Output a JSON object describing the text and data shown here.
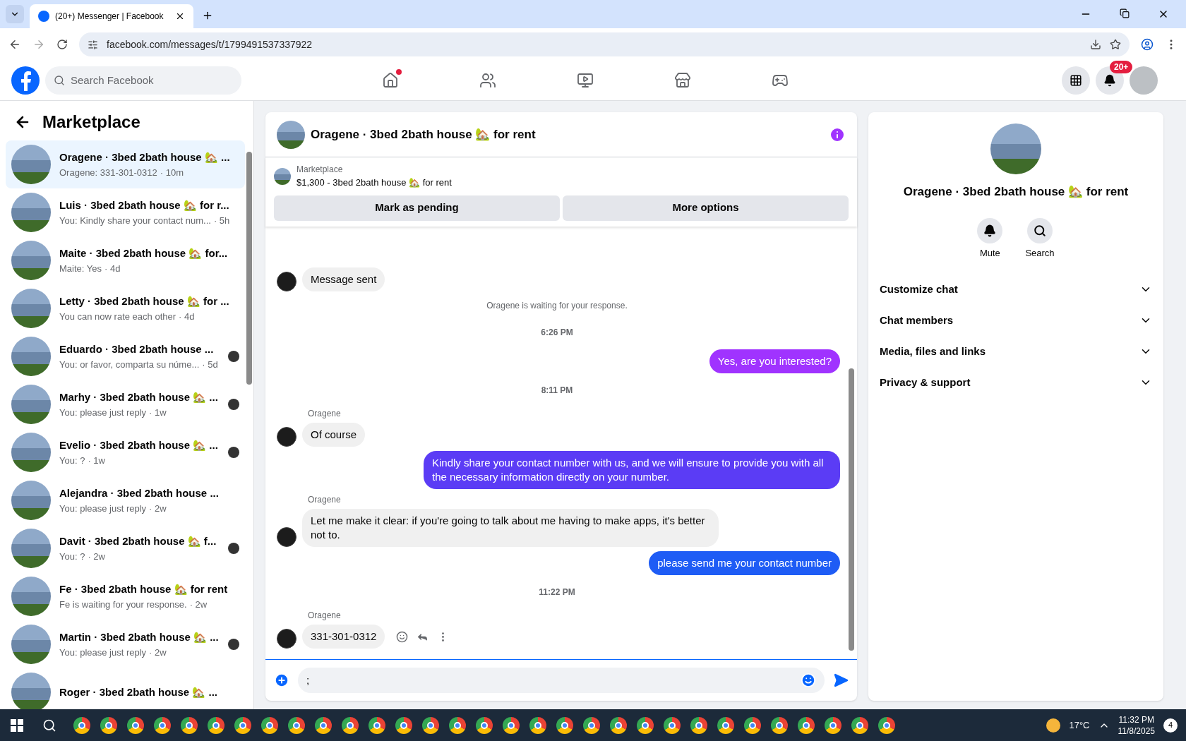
{
  "browser": {
    "tab_title": "(20+) Messenger | Facebook",
    "url": "facebook.com/messages/t/1799491537337922"
  },
  "header": {
    "search_placeholder": "Search Facebook",
    "nav": [
      {
        "kind": "home",
        "dot": true
      },
      {
        "kind": "friends",
        "dot": false
      },
      {
        "kind": "video",
        "dot": false
      },
      {
        "kind": "marketplace",
        "dot": false
      },
      {
        "kind": "gaming",
        "dot": false
      }
    ],
    "notification_badge": "20+"
  },
  "sidebar": {
    "title": "Marketplace",
    "conversations": [
      {
        "title": "Oragene · 3bed 2bath house 🏡 ...",
        "preview": "Oragene: 331-301-0312",
        "time": "· 10m",
        "selected": true,
        "seen": false
      },
      {
        "title": "Luis · 3bed 2bath house 🏡 for r...",
        "preview": "You: Kindly share your contact num...",
        "time": "· 5h",
        "selected": false,
        "seen": false
      },
      {
        "title": "Maite · 3bed 2bath house 🏡 for...",
        "preview": "Maite: Yes",
        "time": "· 4d",
        "selected": false,
        "seen": false
      },
      {
        "title": "Letty · 3bed 2bath house 🏡 for ...",
        "preview": "You can now rate each other",
        "time": "· 4d",
        "selected": false,
        "seen": false
      },
      {
        "title": "Eduardo · 3bed 2bath house ...",
        "preview": "You: or favor, comparta su núme...",
        "time": "· 5d",
        "selected": false,
        "seen": true
      },
      {
        "title": "Marhy · 3bed 2bath house 🏡 ...",
        "preview": "You: please just reply",
        "time": "· 1w",
        "selected": false,
        "seen": true
      },
      {
        "title": "Evelio · 3bed 2bath house 🏡 ...",
        "preview": "You: ?",
        "time": "· 1w",
        "selected": false,
        "seen": true
      },
      {
        "title": "Alejandra · 3bed 2bath house ...",
        "preview": "You: please just reply",
        "time": "· 2w",
        "selected": false,
        "seen": false
      },
      {
        "title": "Davit · 3bed 2bath house 🏡 f...",
        "preview": "You: ?",
        "time": "· 2w",
        "selected": false,
        "seen": true
      },
      {
        "title": "Fe · 3bed 2bath house 🏡 for rent",
        "preview": "Fe is waiting for your response.",
        "time": "· 2w",
        "selected": false,
        "seen": false
      },
      {
        "title": "Martin · 3bed 2bath house 🏡 ...",
        "preview": "You: please just reply",
        "time": "· 2w",
        "selected": false,
        "seen": true
      },
      {
        "title": "Roger · 3bed 2bath house 🏡 ...",
        "selected": false,
        "seen": false
      }
    ]
  },
  "chat": {
    "title": "Oragene · 3bed 2bath house 🏡 for rent",
    "listing": {
      "label": "Marketplace",
      "text": "$1,300 - 3bed 2bath house 🏡 for rent"
    },
    "buttons": [
      "Mark as pending",
      "More options"
    ],
    "messages": [
      {
        "kind": "received",
        "text": "Message sent"
      },
      {
        "kind": "status",
        "text": "Oragene is waiting for your response."
      },
      {
        "kind": "time",
        "text": "6:26 PM"
      },
      {
        "kind": "sent",
        "text": "Yes, are you interested?",
        "color": "#a033ff"
      },
      {
        "kind": "time",
        "text": "8:11 PM"
      },
      {
        "kind": "received",
        "sender": "Oragene",
        "text": "Of course"
      },
      {
        "kind": "sent",
        "text": "Kindly share your contact number with us, and we will ensure to provide you with all the necessary information directly on your number.",
        "color": "#5b3cf5"
      },
      {
        "kind": "received",
        "sender": "Oragene",
        "text": "Let me make it clear: if you're going to talk about me having to make apps, it's better not to."
      },
      {
        "kind": "sent",
        "text": "please send me your  contact number",
        "color": "#1e5cf5"
      },
      {
        "kind": "time",
        "text": "11:22 PM"
      },
      {
        "kind": "received",
        "sender": "Oragene",
        "text": "331-301-0312",
        "actions": true
      }
    ],
    "composer": {
      "value": ";"
    }
  },
  "details": {
    "title": "Oragene · 3bed 2bath house 🏡 for rent",
    "actions": [
      {
        "kind": "mute",
        "label": "Mute"
      },
      {
        "kind": "search",
        "label": "Search"
      }
    ],
    "sections": [
      {
        "label": "Customize chat",
        "expanded": false
      },
      {
        "label": "Chat members",
        "expanded": false
      },
      {
        "label": "Media, files and links",
        "expanded": false
      },
      {
        "label": "Privacy & support",
        "expanded": false
      }
    ]
  },
  "taskbar": {
    "weather": "17°C",
    "time": "11:32 PM",
    "date": "11/8/2025",
    "notifications": "4"
  }
}
